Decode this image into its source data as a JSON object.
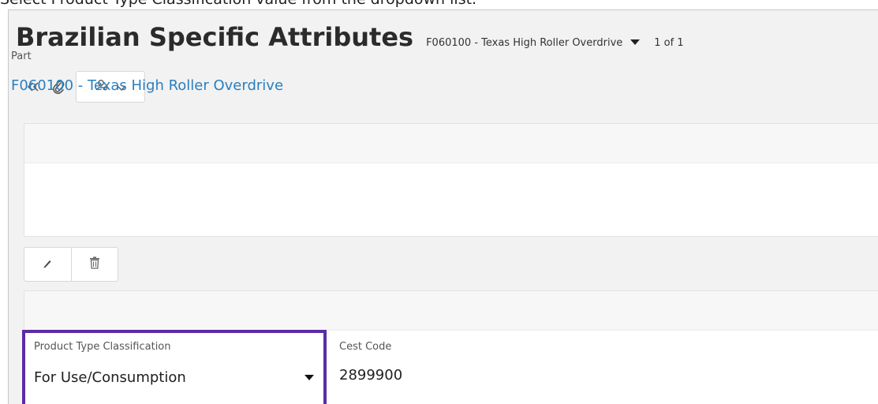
{
  "instruction": "Select Product Type Classification value from the dropdown list.",
  "header": {
    "title": "Brazilian Specific Attributes",
    "record_selector": "F060100 - Texas High Roller Overdrive",
    "record_count": "1 of 1"
  },
  "toolbar": {
    "icons": [
      "collapse-icon",
      "attachment-icon",
      "user-settings-icon",
      "chevron-down-icon"
    ]
  },
  "part_section": {
    "label": "Part",
    "value": "F060100 - Texas High Roller Overdrive"
  },
  "actions": {
    "icons": [
      "edit-icon",
      "delete-icon"
    ]
  },
  "attributes": {
    "product_type_classification": {
      "label": "Product Type Classification",
      "value": "For Use/Consumption"
    },
    "cest_code": {
      "label": "Cest Code",
      "value": "2899900"
    }
  },
  "colors": {
    "highlight": "#5b2aa6",
    "link": "#2a7fbf",
    "title": "#2b2b2b"
  }
}
